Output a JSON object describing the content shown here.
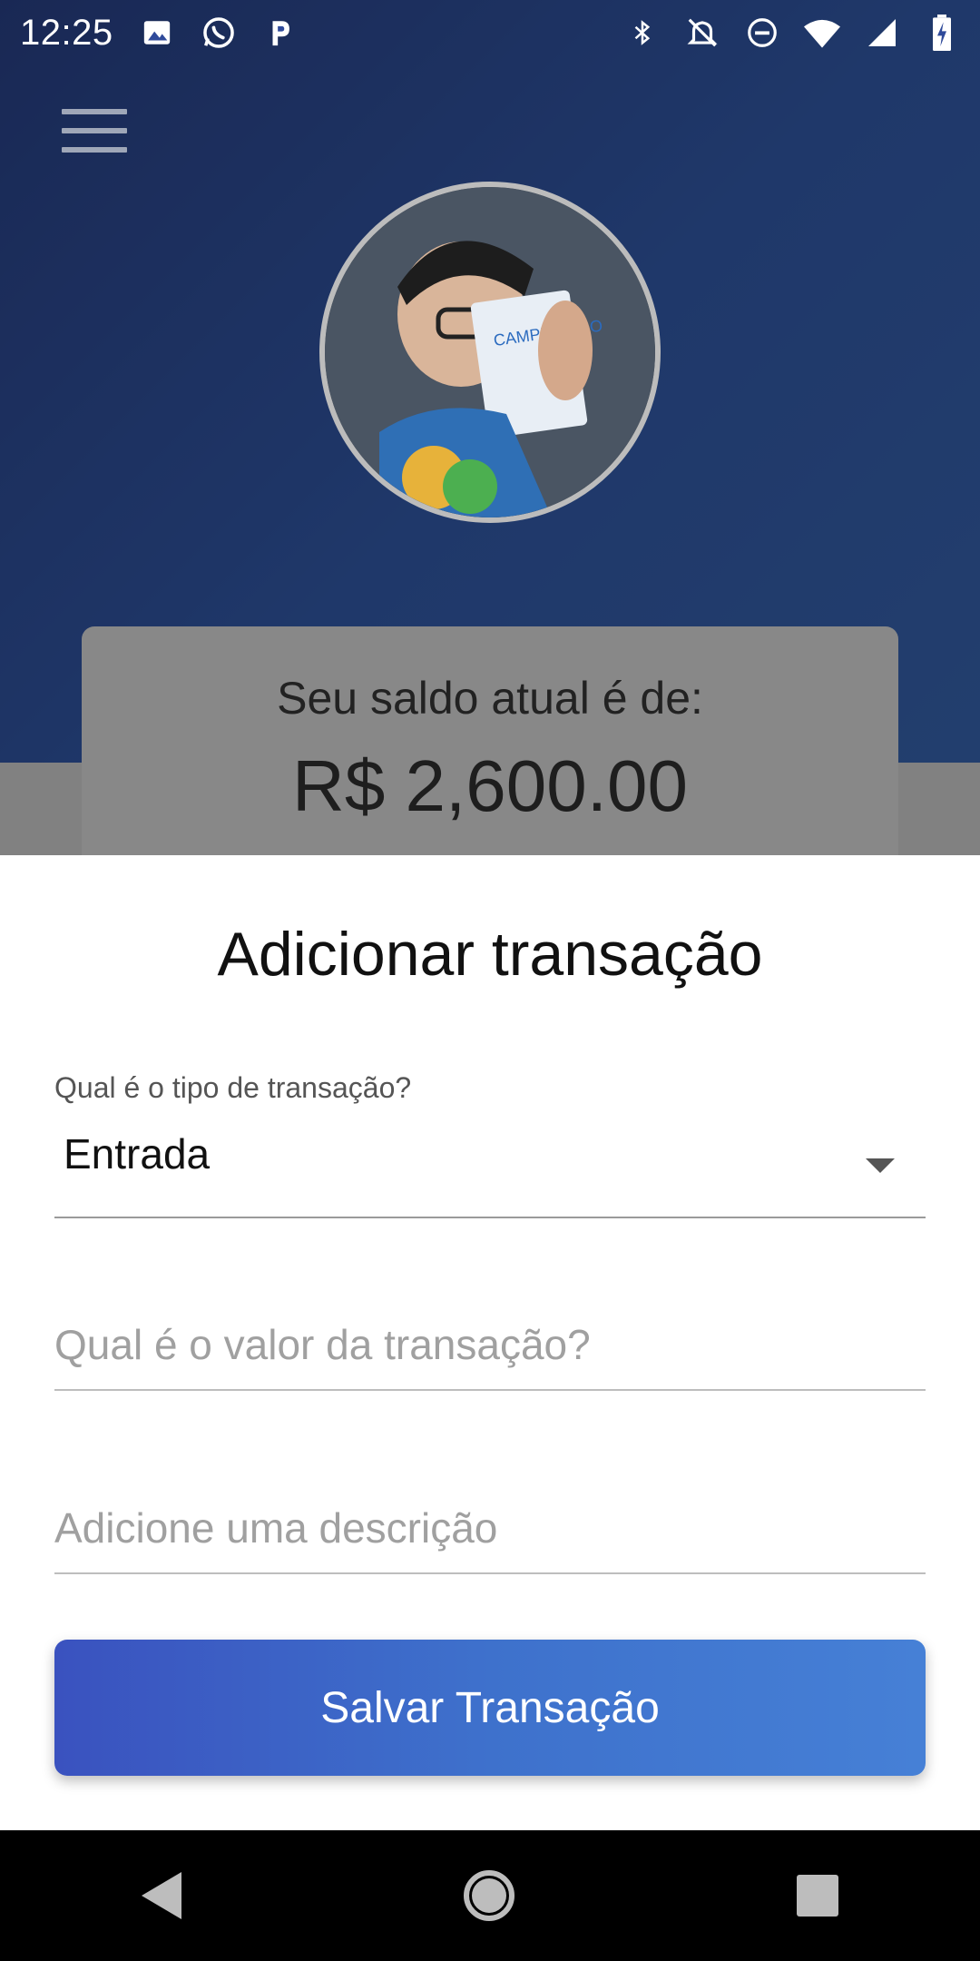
{
  "status_bar": {
    "time": "12:25",
    "left_icons": [
      "image-icon",
      "whatsapp-icon",
      "p-app-icon"
    ],
    "right_icons": [
      "bluetooth-icon",
      "bell-off-icon",
      "do-not-disturb-icon",
      "wifi-icon",
      "signal-icon",
      "battery-charging-icon"
    ]
  },
  "header": {
    "menu_icon": "hamburger-menu-icon",
    "avatar_icon": "profile-photo"
  },
  "balance": {
    "label": "Seu saldo atual é de:",
    "value": "R$ 2,600.00"
  },
  "sheet": {
    "title": "Adicionar transação",
    "type_label": "Qual é o tipo de transação?",
    "type_value": "Entrada",
    "amount_placeholder": "Qual é o valor da transação?",
    "description_placeholder": "Adicione uma descrição",
    "save_label": "Salvar Transação"
  },
  "colors": {
    "header_blue": "#3a67c2",
    "button_start": "#3a52bf",
    "button_end": "#4680d6"
  },
  "nav_bar": {
    "icons": [
      "back-icon",
      "home-icon",
      "recents-icon"
    ]
  }
}
